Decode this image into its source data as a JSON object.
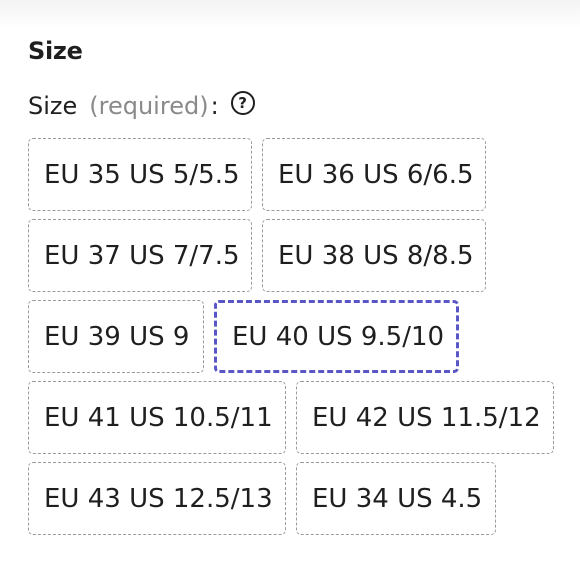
{
  "section": {
    "title": "Size"
  },
  "field": {
    "label": "Size",
    "required": "(required)",
    "colon": ":",
    "help_icon": "question-circle-icon",
    "help_glyph": "?"
  },
  "size_options": [
    {
      "label": "EU 35 US 5/5.5",
      "selected": false
    },
    {
      "label": "EU 36 US 6/6.5",
      "selected": false
    },
    {
      "label": "EU 37 US 7/7.5",
      "selected": false
    },
    {
      "label": "EU 38 US 8/8.5",
      "selected": false
    },
    {
      "label": "EU 39 US 9",
      "selected": false
    },
    {
      "label": "EU 40 US 9.5/10",
      "selected": true
    },
    {
      "label": "EU 41 US 10.5/11",
      "selected": false
    },
    {
      "label": "EU 42 US 11.5/12",
      "selected": false
    },
    {
      "label": "EU 43 US 12.5/13",
      "selected": false
    },
    {
      "label": "EU 34 US 4.5",
      "selected": false
    }
  ],
  "colors": {
    "selected_border": "#5a56c6",
    "option_border": "#9a9a9a",
    "required_text": "#8a8a8a"
  }
}
